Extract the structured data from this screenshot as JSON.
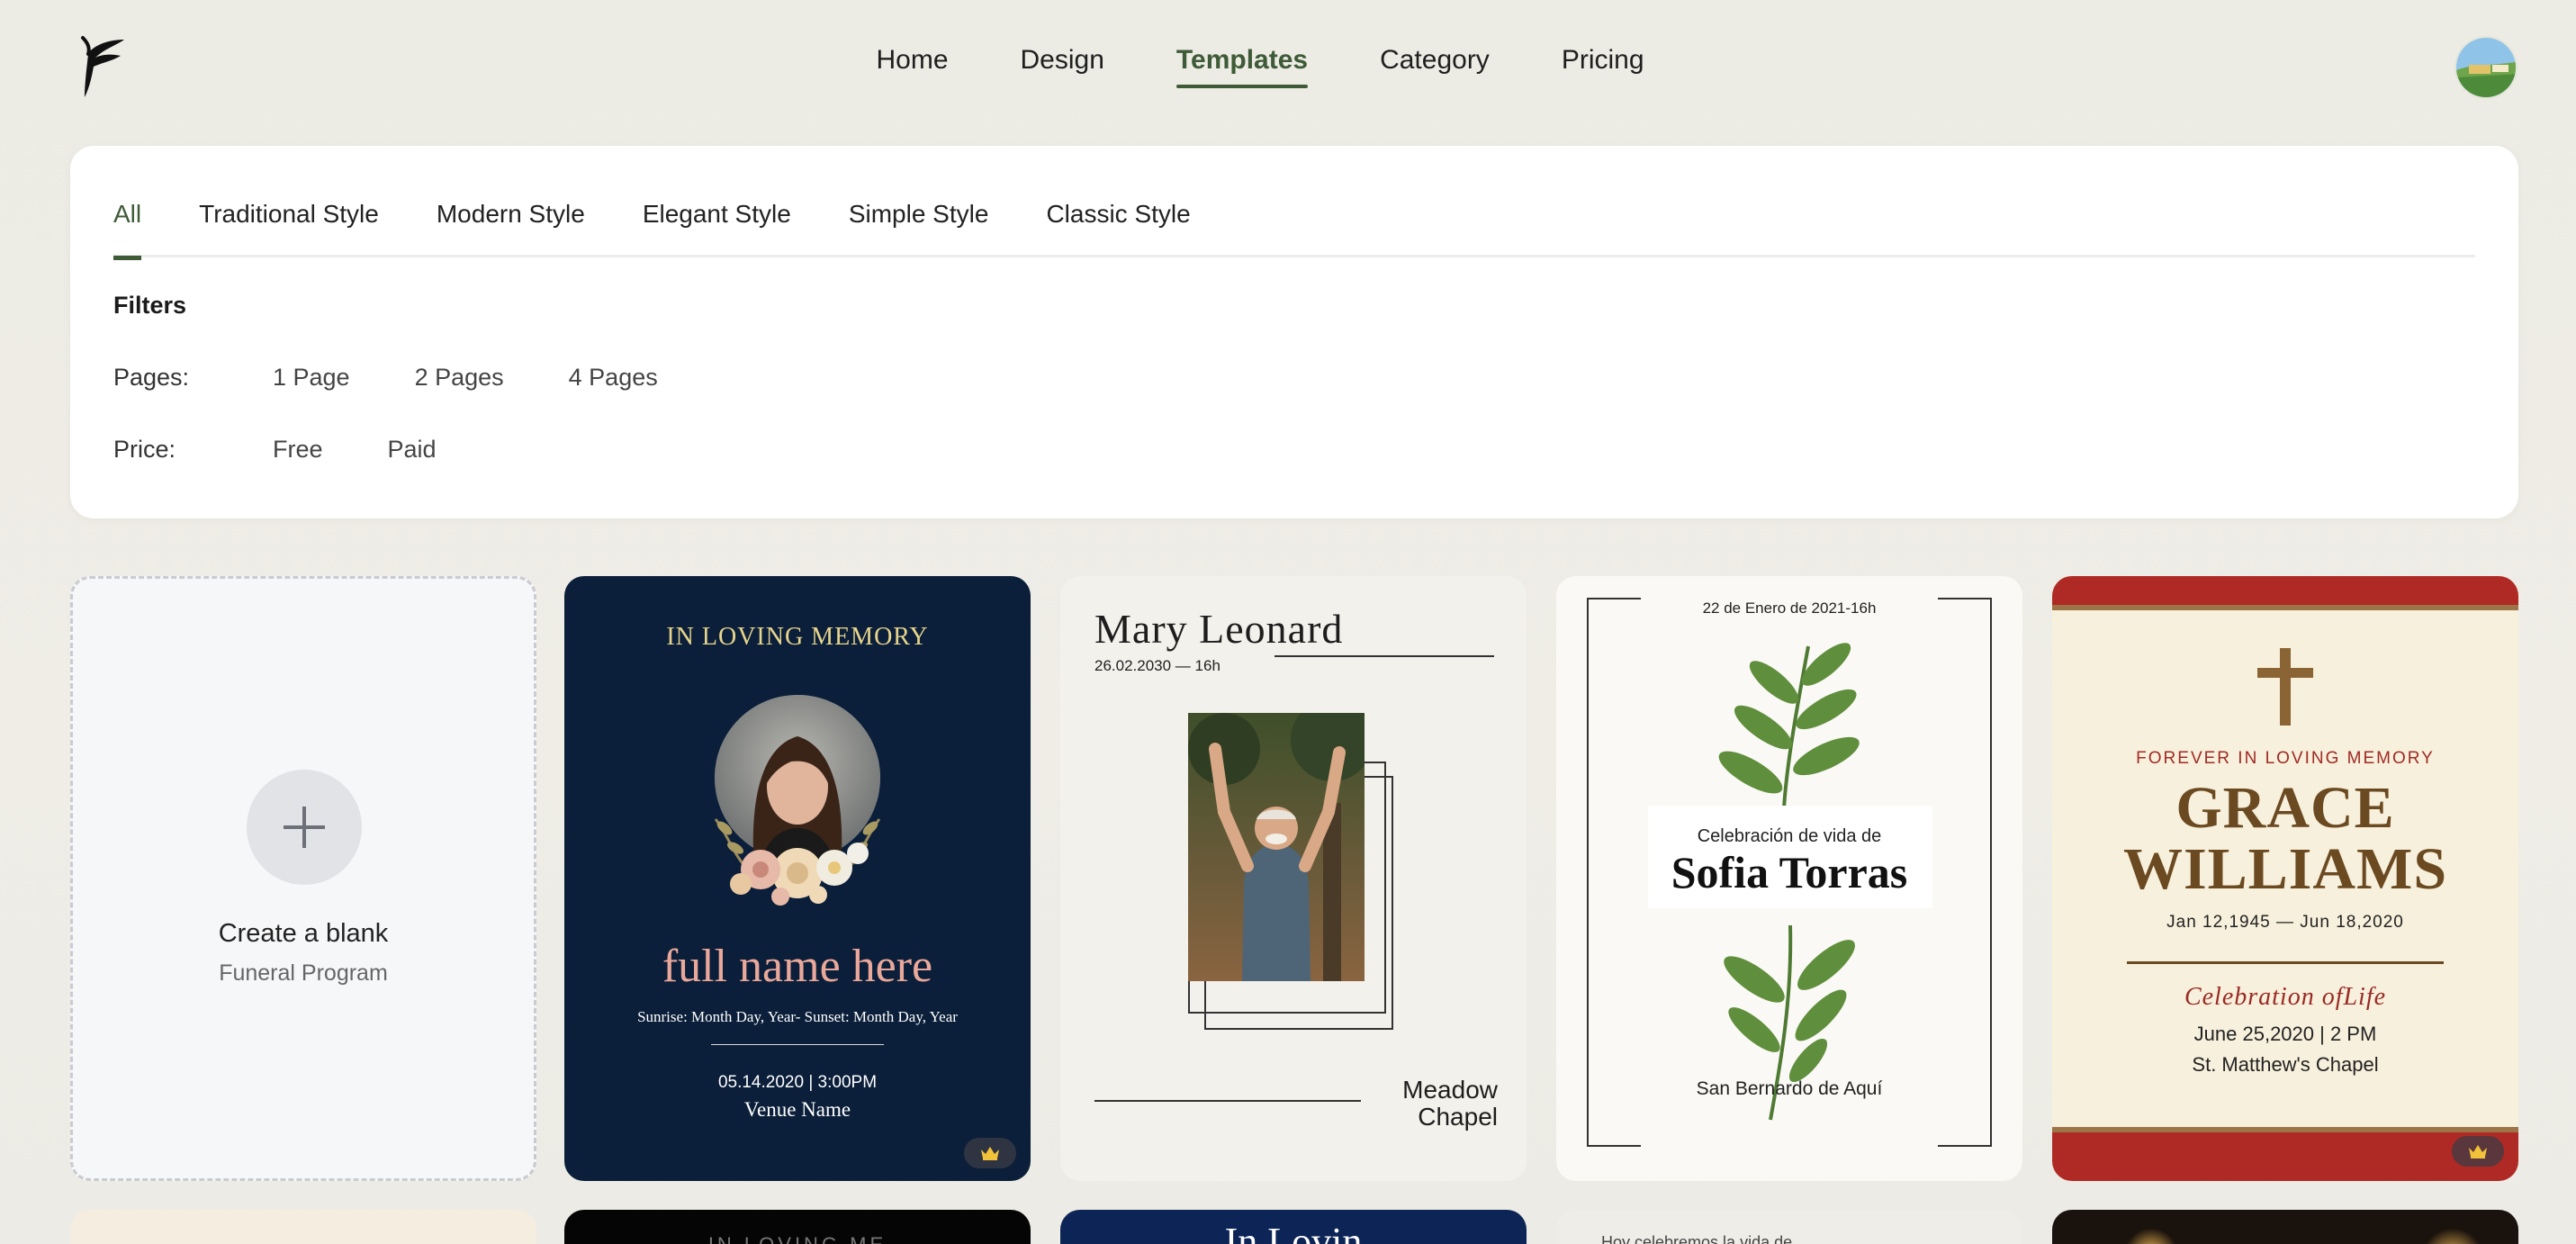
{
  "header": {
    "logo_icon": "feather-f-logo",
    "nav": [
      {
        "label": "Home"
      },
      {
        "label": "Design"
      },
      {
        "label": "Templates",
        "active": true
      },
      {
        "label": "Category"
      },
      {
        "label": "Pricing"
      }
    ],
    "avatar_icon": "user-avatar"
  },
  "filter_panel": {
    "tabs": [
      {
        "label": "All",
        "active": true
      },
      {
        "label": "Traditional Style"
      },
      {
        "label": "Modern Style"
      },
      {
        "label": "Elegant Style"
      },
      {
        "label": "Simple Style"
      },
      {
        "label": "Classic Style"
      }
    ],
    "filters_title": "Filters",
    "pages": {
      "label": "Pages:",
      "options": [
        "1 Page",
        "2 Pages",
        "4 Pages"
      ]
    },
    "price": {
      "label": "Price:",
      "options": [
        "Free",
        "Paid"
      ]
    }
  },
  "templates": {
    "blank": {
      "title": "Create a blank",
      "subtitle": "Funeral Program"
    },
    "card2": {
      "heading": "IN LOVING  MEMORY",
      "name": "full name here",
      "dates": "Sunrise: Month Day, Year- Sunset: Month Day, Year",
      "datetime": "05.14.2020 | 3:00PM",
      "venue": "Venue Name",
      "premium": true
    },
    "card3": {
      "name": "Mary  Leonard",
      "date": "26.02.2030 — 16h",
      "place_line1": "Meadow",
      "place_line2": "Chapel"
    },
    "card4": {
      "date": "22 de Enero de 2021-16h",
      "celebration": "Celebración de vida de",
      "name": "Sofia Torras",
      "location": "San Bernardo de Aquí"
    },
    "card5": {
      "forever": "FOREVER IN LOVING MEMORY",
      "name_line1": "GRACE",
      "name_line2": "WILLIAMS",
      "dates": "Jan 12,1945 — Jun 18,2020",
      "celebration": "Celebration ofLife",
      "datetime": "June 25,2020 | 2 PM",
      "chapel": "St. Matthew's Chapel",
      "premium": true
    }
  },
  "second_row": {
    "card3_text": "In Lovin",
    "card4_text": "Hoy celebremos la vida de",
    "card2_text": "IN LOVING ME"
  },
  "colors": {
    "accent": "#3e5a37",
    "navy": "#0b1f3a",
    "crimson": "#b02a25",
    "gold": "#f2c23a"
  }
}
